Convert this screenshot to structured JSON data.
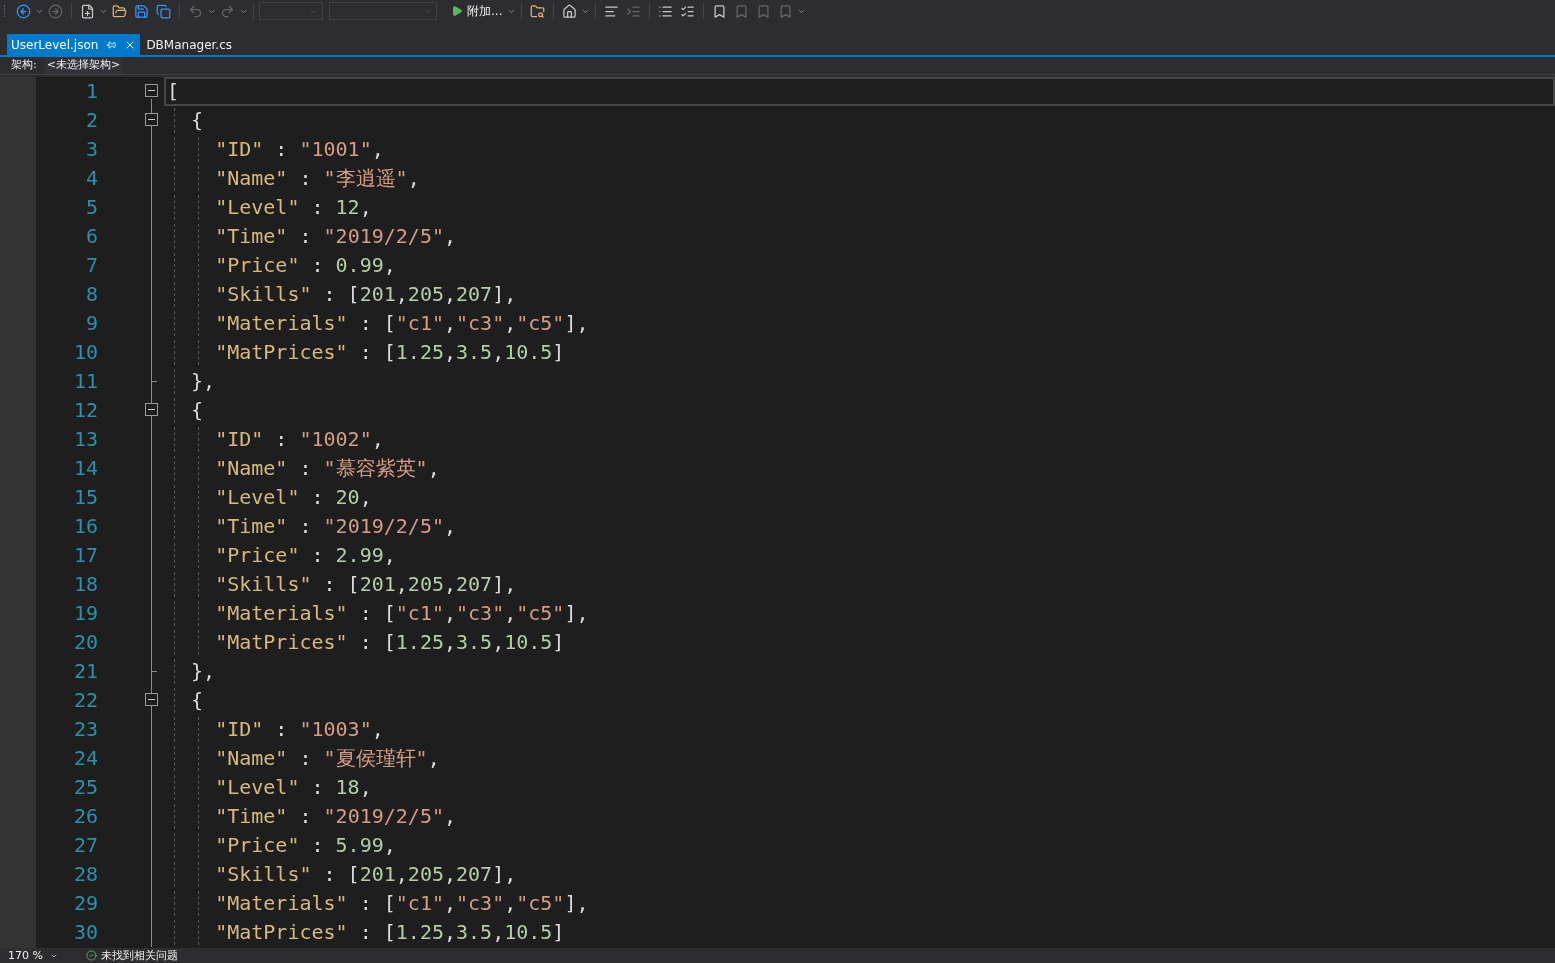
{
  "toolbar": {
    "run_label": "附加..."
  },
  "tabs": [
    {
      "label": "UserLevel.json",
      "selected": true,
      "pinnable": true
    },
    {
      "label": "DBManager.cs",
      "selected": false,
      "pinnable": false
    }
  ],
  "navigation_bar": {
    "label": "架构:",
    "value": "<未选择架构>"
  },
  "editor": {
    "lines": [
      {
        "number": "1",
        "kind": "fold_start",
        "expanded": true,
        "current": true,
        "tokens": [
          {
            "kind": "punct",
            "text": "["
          }
        ]
      },
      {
        "number": "2",
        "kind": "fold_start",
        "expanded": true,
        "current": false,
        "tokens": [
          {
            "kind": "punct",
            "text": "  {"
          }
        ]
      },
      {
        "number": "3",
        "kind": "plain",
        "current": false,
        "tokens": [
          {
            "kind": "key",
            "text": "    \"ID\""
          },
          {
            "kind": "punct",
            "text": " : "
          },
          {
            "kind": "string",
            "text": "\"1001\""
          },
          {
            "kind": "punct",
            "text": ","
          }
        ]
      },
      {
        "number": "4",
        "kind": "plain",
        "current": false,
        "tokens": [
          {
            "kind": "key",
            "text": "    \"Name\""
          },
          {
            "kind": "punct",
            "text": " : "
          },
          {
            "kind": "string",
            "text": "\"李逍遥\""
          },
          {
            "kind": "punct",
            "text": ","
          }
        ]
      },
      {
        "number": "5",
        "kind": "plain",
        "current": false,
        "tokens": [
          {
            "kind": "key",
            "text": "    \"Level\""
          },
          {
            "kind": "punct",
            "text": " : "
          },
          {
            "kind": "number",
            "text": "12"
          },
          {
            "kind": "punct",
            "text": ","
          }
        ]
      },
      {
        "number": "6",
        "kind": "plain",
        "current": false,
        "tokens": [
          {
            "kind": "key",
            "text": "    \"Time\""
          },
          {
            "kind": "punct",
            "text": " : "
          },
          {
            "kind": "string",
            "text": "\"2019/2/5\""
          },
          {
            "kind": "punct",
            "text": ","
          }
        ]
      },
      {
        "number": "7",
        "kind": "plain",
        "current": false,
        "tokens": [
          {
            "kind": "key",
            "text": "    \"Price\""
          },
          {
            "kind": "punct",
            "text": " : "
          },
          {
            "kind": "number",
            "text": "0.99"
          },
          {
            "kind": "punct",
            "text": ","
          }
        ]
      },
      {
        "number": "8",
        "kind": "plain",
        "current": false,
        "tokens": [
          {
            "kind": "key",
            "text": "    \"Skills\""
          },
          {
            "kind": "punct",
            "text": " : ["
          },
          {
            "kind": "number",
            "text": "201"
          },
          {
            "kind": "punct",
            "text": ","
          },
          {
            "kind": "number",
            "text": "205"
          },
          {
            "kind": "punct",
            "text": ","
          },
          {
            "kind": "number",
            "text": "207"
          },
          {
            "kind": "punct",
            "text": "],"
          }
        ]
      },
      {
        "number": "9",
        "kind": "plain",
        "current": false,
        "tokens": [
          {
            "kind": "key",
            "text": "    \"Materials\""
          },
          {
            "kind": "punct",
            "text": " : ["
          },
          {
            "kind": "string",
            "text": "\"c1\""
          },
          {
            "kind": "punct",
            "text": ","
          },
          {
            "kind": "string",
            "text": "\"c3\""
          },
          {
            "kind": "punct",
            "text": ","
          },
          {
            "kind": "string",
            "text": "\"c5\""
          },
          {
            "kind": "punct",
            "text": "],"
          }
        ]
      },
      {
        "number": "10",
        "kind": "plain",
        "current": false,
        "tokens": [
          {
            "kind": "key",
            "text": "    \"MatPrices\""
          },
          {
            "kind": "punct",
            "text": " : ["
          },
          {
            "kind": "number",
            "text": "1.25"
          },
          {
            "kind": "punct",
            "text": ","
          },
          {
            "kind": "number",
            "text": "3.5"
          },
          {
            "kind": "punct",
            "text": ","
          },
          {
            "kind": "number",
            "text": "10.5"
          },
          {
            "kind": "punct",
            "text": "]"
          }
        ]
      },
      {
        "number": "11",
        "kind": "fold_end",
        "current": false,
        "tokens": [
          {
            "kind": "punct",
            "text": "  },"
          }
        ]
      },
      {
        "number": "12",
        "kind": "fold_start",
        "expanded": true,
        "current": false,
        "tokens": [
          {
            "kind": "punct",
            "text": "  {"
          }
        ]
      },
      {
        "number": "13",
        "kind": "plain",
        "current": false,
        "tokens": [
          {
            "kind": "key",
            "text": "    \"ID\""
          },
          {
            "kind": "punct",
            "text": " : "
          },
          {
            "kind": "string",
            "text": "\"1002\""
          },
          {
            "kind": "punct",
            "text": ","
          }
        ]
      },
      {
        "number": "14",
        "kind": "plain",
        "current": false,
        "tokens": [
          {
            "kind": "key",
            "text": "    \"Name\""
          },
          {
            "kind": "punct",
            "text": " : "
          },
          {
            "kind": "string",
            "text": "\"慕容紫英\""
          },
          {
            "kind": "punct",
            "text": ","
          }
        ]
      },
      {
        "number": "15",
        "kind": "plain",
        "current": false,
        "tokens": [
          {
            "kind": "key",
            "text": "    \"Level\""
          },
          {
            "kind": "punct",
            "text": " : "
          },
          {
            "kind": "number",
            "text": "20"
          },
          {
            "kind": "punct",
            "text": ","
          }
        ]
      },
      {
        "number": "16",
        "kind": "plain",
        "current": false,
        "tokens": [
          {
            "kind": "key",
            "text": "    \"Time\""
          },
          {
            "kind": "punct",
            "text": " : "
          },
          {
            "kind": "string",
            "text": "\"2019/2/5\""
          },
          {
            "kind": "punct",
            "text": ","
          }
        ]
      },
      {
        "number": "17",
        "kind": "plain",
        "current": false,
        "tokens": [
          {
            "kind": "key",
            "text": "    \"Price\""
          },
          {
            "kind": "punct",
            "text": " : "
          },
          {
            "kind": "number",
            "text": "2.99"
          },
          {
            "kind": "punct",
            "text": ","
          }
        ]
      },
      {
        "number": "18",
        "kind": "plain",
        "current": false,
        "tokens": [
          {
            "kind": "key",
            "text": "    \"Skills\""
          },
          {
            "kind": "punct",
            "text": " : ["
          },
          {
            "kind": "number",
            "text": "201"
          },
          {
            "kind": "punct",
            "text": ","
          },
          {
            "kind": "number",
            "text": "205"
          },
          {
            "kind": "punct",
            "text": ","
          },
          {
            "kind": "number",
            "text": "207"
          },
          {
            "kind": "punct",
            "text": "],"
          }
        ]
      },
      {
        "number": "19",
        "kind": "plain",
        "current": false,
        "tokens": [
          {
            "kind": "key",
            "text": "    \"Materials\""
          },
          {
            "kind": "punct",
            "text": " : ["
          },
          {
            "kind": "string",
            "text": "\"c1\""
          },
          {
            "kind": "punct",
            "text": ","
          },
          {
            "kind": "string",
            "text": "\"c3\""
          },
          {
            "kind": "punct",
            "text": ","
          },
          {
            "kind": "string",
            "text": "\"c5\""
          },
          {
            "kind": "punct",
            "text": "],"
          }
        ]
      },
      {
        "number": "20",
        "kind": "plain",
        "current": false,
        "tokens": [
          {
            "kind": "key",
            "text": "    \"MatPrices\""
          },
          {
            "kind": "punct",
            "text": " : ["
          },
          {
            "kind": "number",
            "text": "1.25"
          },
          {
            "kind": "punct",
            "text": ","
          },
          {
            "kind": "number",
            "text": "3.5"
          },
          {
            "kind": "punct",
            "text": ","
          },
          {
            "kind": "number",
            "text": "10.5"
          },
          {
            "kind": "punct",
            "text": "]"
          }
        ]
      },
      {
        "number": "21",
        "kind": "fold_end",
        "current": false,
        "tokens": [
          {
            "kind": "punct",
            "text": "  },"
          }
        ]
      },
      {
        "number": "22",
        "kind": "fold_start",
        "expanded": true,
        "current": false,
        "tokens": [
          {
            "kind": "punct",
            "text": "  {"
          }
        ]
      },
      {
        "number": "23",
        "kind": "plain",
        "current": false,
        "tokens": [
          {
            "kind": "key",
            "text": "    \"ID\""
          },
          {
            "kind": "punct",
            "text": " : "
          },
          {
            "kind": "string",
            "text": "\"1003\""
          },
          {
            "kind": "punct",
            "text": ","
          }
        ]
      },
      {
        "number": "24",
        "kind": "plain",
        "current": false,
        "tokens": [
          {
            "kind": "key",
            "text": "    \"Name\""
          },
          {
            "kind": "punct",
            "text": " : "
          },
          {
            "kind": "string",
            "text": "\"夏侯瑾轩\""
          },
          {
            "kind": "punct",
            "text": ","
          }
        ]
      },
      {
        "number": "25",
        "kind": "plain",
        "current": false,
        "tokens": [
          {
            "kind": "key",
            "text": "    \"Level\""
          },
          {
            "kind": "punct",
            "text": " : "
          },
          {
            "kind": "number",
            "text": "18"
          },
          {
            "kind": "punct",
            "text": ","
          }
        ]
      },
      {
        "number": "26",
        "kind": "plain",
        "current": false,
        "tokens": [
          {
            "kind": "key",
            "text": "    \"Time\""
          },
          {
            "kind": "punct",
            "text": " : "
          },
          {
            "kind": "string",
            "text": "\"2019/2/5\""
          },
          {
            "kind": "punct",
            "text": ","
          }
        ]
      },
      {
        "number": "27",
        "kind": "plain",
        "current": false,
        "tokens": [
          {
            "kind": "key",
            "text": "    \"Price\""
          },
          {
            "kind": "punct",
            "text": " : "
          },
          {
            "kind": "number",
            "text": "5.99"
          },
          {
            "kind": "punct",
            "text": ","
          }
        ]
      },
      {
        "number": "28",
        "kind": "plain",
        "current": false,
        "tokens": [
          {
            "kind": "key",
            "text": "    \"Skills\""
          },
          {
            "kind": "punct",
            "text": " : ["
          },
          {
            "kind": "number",
            "text": "201"
          },
          {
            "kind": "punct",
            "text": ","
          },
          {
            "kind": "number",
            "text": "205"
          },
          {
            "kind": "punct",
            "text": ","
          },
          {
            "kind": "number",
            "text": "207"
          },
          {
            "kind": "punct",
            "text": "],"
          }
        ]
      },
      {
        "number": "29",
        "kind": "plain",
        "current": false,
        "tokens": [
          {
            "kind": "key",
            "text": "    \"Materials\""
          },
          {
            "kind": "punct",
            "text": " : ["
          },
          {
            "kind": "string",
            "text": "\"c1\""
          },
          {
            "kind": "punct",
            "text": ","
          },
          {
            "kind": "string",
            "text": "\"c3\""
          },
          {
            "kind": "punct",
            "text": ","
          },
          {
            "kind": "string",
            "text": "\"c5\""
          },
          {
            "kind": "punct",
            "text": "],"
          }
        ]
      },
      {
        "number": "30",
        "kind": "plain",
        "current": false,
        "tokens": [
          {
            "kind": "key",
            "text": "    \"MatPrices\""
          },
          {
            "kind": "punct",
            "text": " : ["
          },
          {
            "kind": "number",
            "text": "1.25"
          },
          {
            "kind": "punct",
            "text": ","
          },
          {
            "kind": "number",
            "text": "3.5"
          },
          {
            "kind": "punct",
            "text": ","
          },
          {
            "kind": "number",
            "text": "10.5"
          },
          {
            "kind": "punct",
            "text": "]"
          }
        ]
      }
    ]
  },
  "status_bar": {
    "zoom": "170 %",
    "issues": "未找到相关问题"
  }
}
